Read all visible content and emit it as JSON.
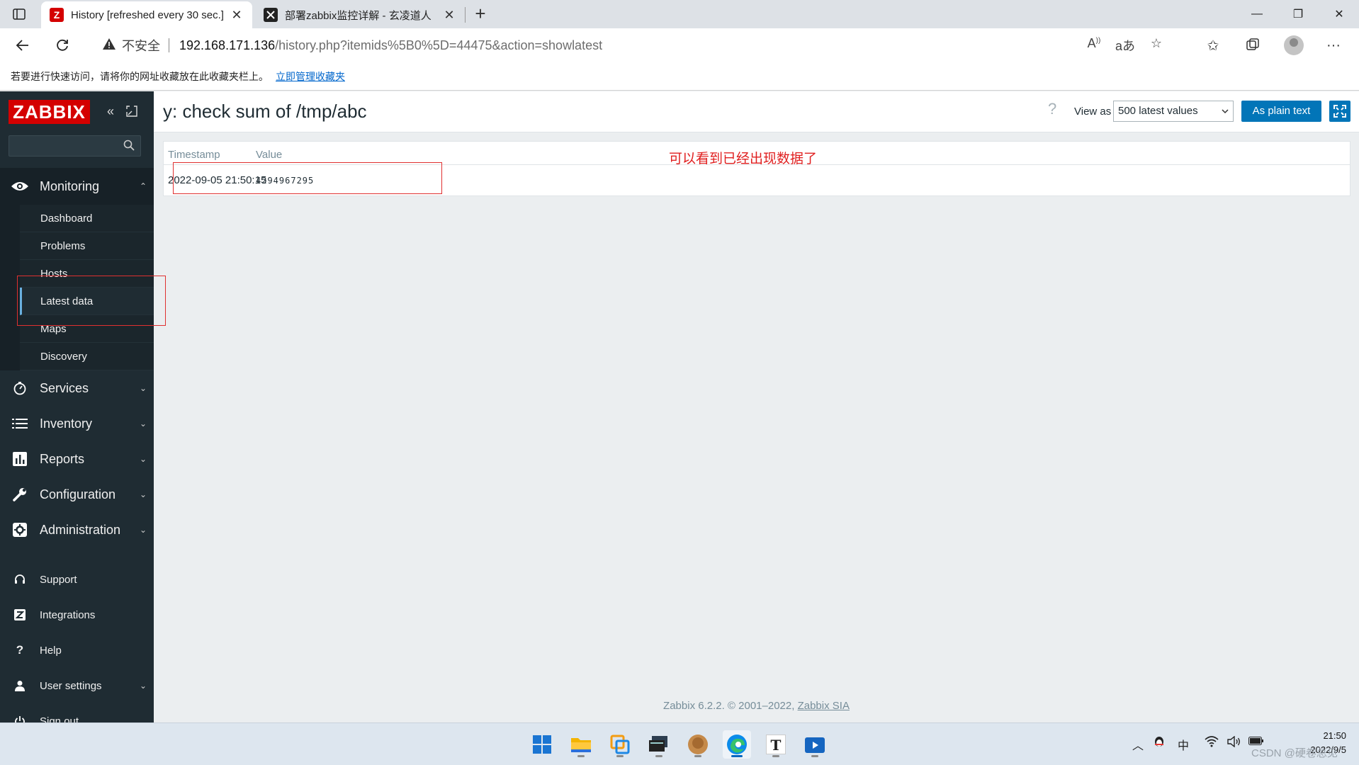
{
  "browser": {
    "tabs": [
      {
        "title": "History [refreshed every 30 sec.]",
        "favicon": "zabbix-favicon",
        "active": true
      },
      {
        "title": "部署zabbix监控详解 - 玄凌道人",
        "favicon": "site-favicon",
        "active": false
      }
    ],
    "window_controls": {
      "minimize": "—",
      "restore": "❐",
      "close": "✕"
    },
    "address": {
      "security_label": "不安全",
      "host": "192.168.171.136",
      "path": "/history.php?itemids%5B0%5D=44475&action=showlatest"
    },
    "favorites_bar": {
      "message": "若要进行快速访问，请将你的网址收藏放在此收藏夹栏上。",
      "link": "立即管理收藏夹"
    }
  },
  "zabbix": {
    "logo": "ZABBIX",
    "menu": [
      {
        "label": "Monitoring",
        "icon": "eye-icon",
        "expanded": true
      },
      {
        "label": "Services",
        "icon": "clock-icon"
      },
      {
        "label": "Inventory",
        "icon": "list-icon"
      },
      {
        "label": "Reports",
        "icon": "bar-chart-icon"
      },
      {
        "label": "Configuration",
        "icon": "wrench-icon"
      },
      {
        "label": "Administration",
        "icon": "gear-icon"
      }
    ],
    "submenu": [
      "Dashboard",
      "Problems",
      "Hosts",
      "Latest data",
      "Maps",
      "Discovery"
    ],
    "selected_submenu": "Latest data",
    "bottom_menu": [
      {
        "label": "Support",
        "icon": "headset-icon"
      },
      {
        "label": "Integrations",
        "icon": "zabbix-z-icon"
      },
      {
        "label": "Help",
        "icon": "question-icon"
      },
      {
        "label": "User settings",
        "icon": "user-icon"
      },
      {
        "label": "Sign out",
        "icon": "power-icon"
      }
    ],
    "page": {
      "title": "y: check sum of /tmp/abc",
      "help": "?",
      "view_as_label": "View as",
      "view_as_value": "500 latest values",
      "plain_text_button": "As plain text",
      "table": {
        "columns": [
          "Timestamp",
          "Value"
        ],
        "rows": [
          {
            "timestamp": "2022-09-05 21:50:15",
            "value": "4294967295"
          }
        ]
      }
    },
    "annotation": "可以看到已经出现数据了",
    "footer": {
      "version": "Zabbix 6.2.2. © 2001–2022,",
      "company": "Zabbix SIA"
    }
  },
  "taskbar": {
    "apps": [
      "start-icon",
      "file-explorer-icon",
      "vmware-icon",
      "terminal-icon",
      "qq-icon",
      "edge-icon",
      "typora-icon",
      "media-icon"
    ],
    "tray": {
      "ime": "中",
      "time": "21:50",
      "date": "2022/9/5"
    },
    "watermark": "CSDN @硬卷总见"
  },
  "colors": {
    "zabbix_sidebar": "#1f2c33",
    "zabbix_red": "#d40000",
    "zabbix_blue": "#0275b8",
    "annotation_red": "#e03030"
  }
}
